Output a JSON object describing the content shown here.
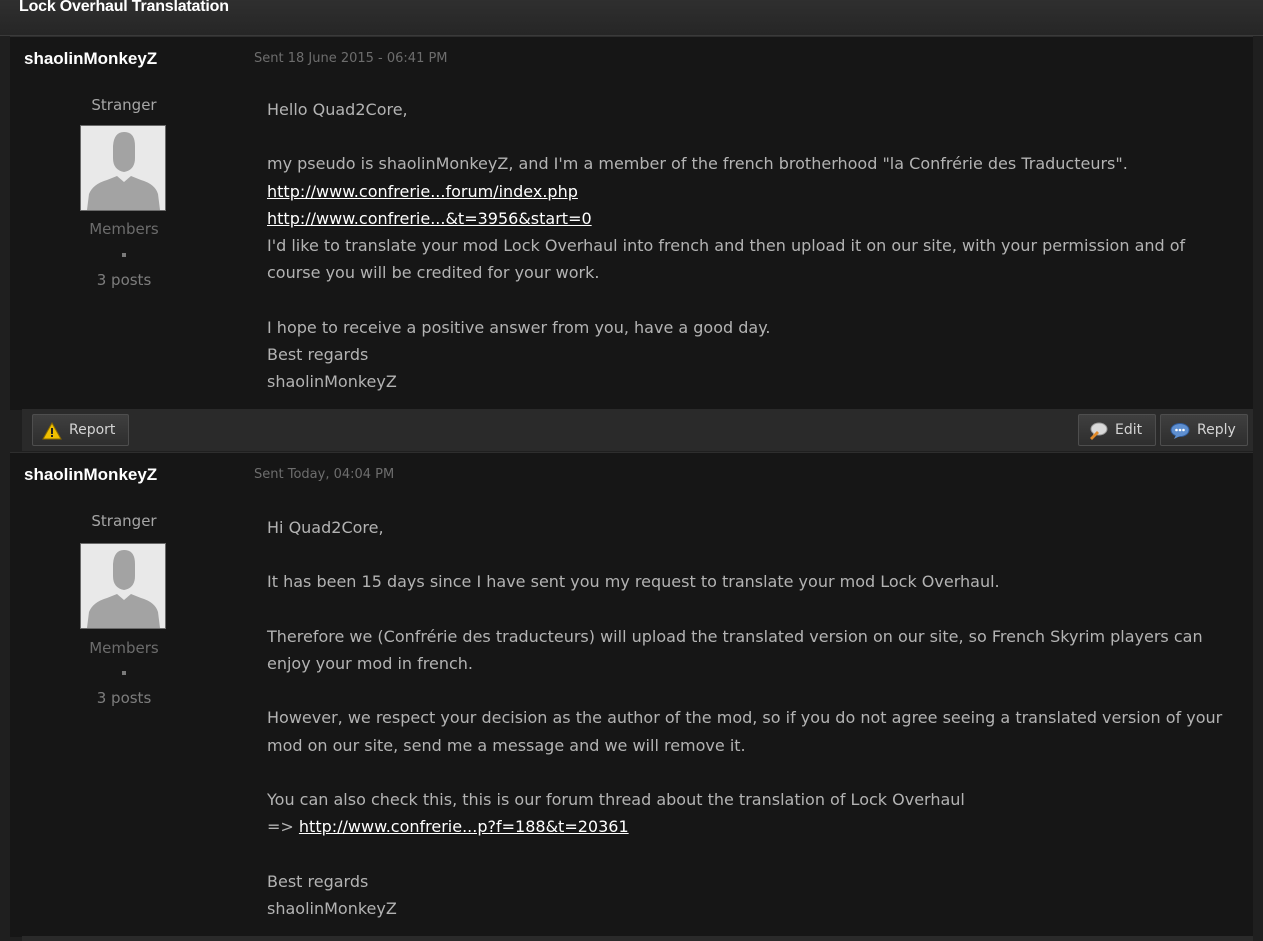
{
  "conversation": {
    "title": "Lock Overhaul Translatation"
  },
  "posts": [
    {
      "author": "shaolinMonkeyZ",
      "sent": "Sent 18 June 2015 - 06:41 PM",
      "rank": "Stranger",
      "group": "Members",
      "post_count": "3 posts",
      "lines": {
        "l1": "Hello Quad2Core,",
        "l2": "my pseudo is shaolinMonkeyZ, and I'm a member of the french brotherhood \"la Confrérie des Traducteurs\".",
        "link1": "http://www.confrerie...forum/index.php",
        "link2": "http://www.confrerie...&t=3956&start=0",
        "l3": "I'd like to translate your mod Lock Overhaul into french and then upload it on our site, with your permission and of course you will be credited for your work.",
        "l4": "I hope to receive a positive answer from you, have a good day.",
        "l5": "Best regards",
        "l6": "shaolinMonkeyZ"
      }
    },
    {
      "author": "shaolinMonkeyZ",
      "sent": "Sent Today, 04:04 PM",
      "rank": "Stranger",
      "group": "Members",
      "post_count": "3 posts",
      "lines": {
        "l1": "Hi Quad2Core,",
        "l2": "It has been 15 days since I have sent you my request to translate your mod Lock Overhaul.",
        "l3": "Therefore we (Confrérie des traducteurs) will upload the translated version on our site, so French Skyrim players can enjoy your mod in french.",
        "l4": "However, we respect your decision as the author of the mod, so if you do not agree seeing a translated version of your mod on our site, send me a message and we will remove it.",
        "l5": "You can also check this, this is our forum thread about the translation of Lock Overhaul",
        "arrow": "=>",
        "link": "http://www.confrerie...p?f=188&t=20361",
        "l6": "Best regards",
        "l7": "shaolinMonkeyZ"
      }
    }
  ],
  "controls": {
    "report_label": "Report",
    "edit_label": "Edit",
    "reply_label": "Reply"
  },
  "icons": {
    "report": "warning-triangle-icon",
    "edit": "edit-bubble-icon",
    "reply": "reply-bubble-icon"
  },
  "colors": {
    "link": "#ffffff",
    "warning": "#f0c000",
    "reply_bubble": "#5e8fd0"
  }
}
